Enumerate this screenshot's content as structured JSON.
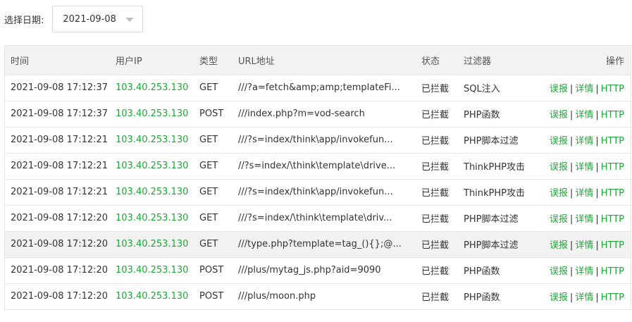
{
  "filter": {
    "label": "选择日期:",
    "date": "2021-09-08"
  },
  "table": {
    "headers": {
      "time": "时间",
      "ip": "用户IP",
      "type": "类型",
      "url": "URL地址",
      "status": "状态",
      "filter": "过滤器",
      "ops": "操作"
    },
    "actions": {
      "misreport": "误报",
      "details": "详情",
      "http": "HTTP",
      "separator": "|"
    },
    "rows": [
      {
        "time": "2021-09-08 17:12:37",
        "ip": "103.40.253.130",
        "type": "GET",
        "url": "///?a=fetch&amp;amp;templateFi...",
        "status": "已拦截",
        "filter": "SQL注入"
      },
      {
        "time": "2021-09-08 17:12:37",
        "ip": "103.40.253.130",
        "type": "POST",
        "url": "///index.php?m=vod-search",
        "status": "已拦截",
        "filter": "PHP函数"
      },
      {
        "time": "2021-09-08 17:12:21",
        "ip": "103.40.253.130",
        "type": "GET",
        "url": "///?s=index/think\\app/invokefun...",
        "status": "已拦截",
        "filter": "PHP脚本过滤"
      },
      {
        "time": "2021-09-08 17:12:21",
        "ip": "103.40.253.130",
        "type": "GET",
        "url": "//?s=index/\\think\\template\\drive...",
        "status": "已拦截",
        "filter": "ThinkPHP攻击"
      },
      {
        "time": "2021-09-08 17:12:21",
        "ip": "103.40.253.130",
        "type": "GET",
        "url": "///?s=index/think\\app/invokefun...",
        "status": "已拦截",
        "filter": "ThinkPHP攻击"
      },
      {
        "time": "2021-09-08 17:12:20",
        "ip": "103.40.253.130",
        "type": "GET",
        "url": "///?s=index/\\think\\template\\driv...",
        "status": "已拦截",
        "filter": "PHP脚本过滤"
      },
      {
        "time": "2021-09-08 17:12:20",
        "ip": "103.40.253.130",
        "type": "GET",
        "url": "///type.php?template=tag_(){};@...",
        "status": "已拦截",
        "filter": "PHP脚本过滤"
      },
      {
        "time": "2021-09-08 17:12:20",
        "ip": "103.40.253.130",
        "type": "POST",
        "url": "///plus/mytag_js.php?aid=9090",
        "status": "已拦截",
        "filter": "PHP函数"
      },
      {
        "time": "2021-09-08 17:12:20",
        "ip": "103.40.253.130",
        "type": "POST",
        "url": "///plus/moon.php",
        "status": "已拦截",
        "filter": "PHP函数"
      }
    ],
    "highlighted_row": 6
  },
  "colors": {
    "accent": "#20a53a",
    "header_bg": "#f2f2f2",
    "border": "#e6e6e6"
  }
}
